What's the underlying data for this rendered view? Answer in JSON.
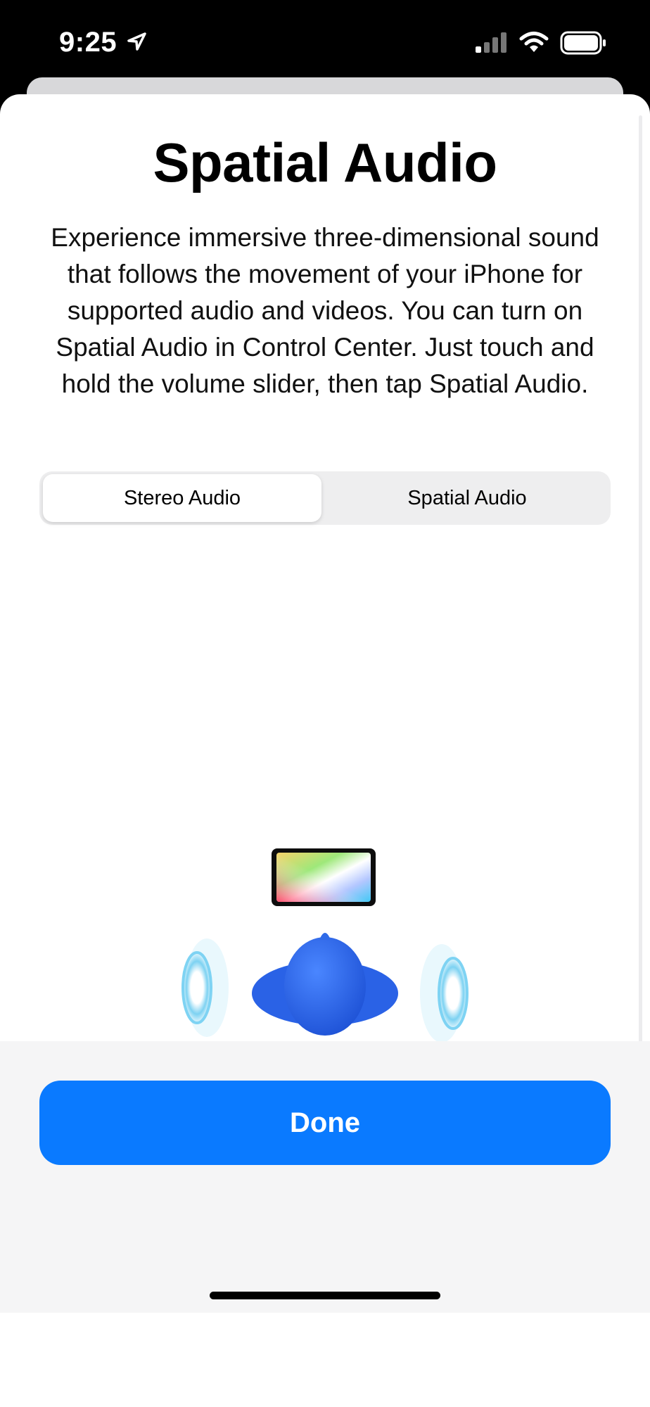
{
  "status_bar": {
    "time": "9:25",
    "location_icon": "location-arrow-icon",
    "signal_icon": "cellular-signal-icon",
    "wifi_icon": "wifi-icon",
    "battery_icon": "battery-icon"
  },
  "sheet": {
    "title": "Spatial Audio",
    "description": "Experience immersive three-dimensional sound that follows the movement of your iPhone for supported audio and videos. You can turn on Spatial Audio in Control Center. Just touch and hold the volume slider, then tap Spatial Audio.",
    "segments": [
      {
        "label": "Stereo Audio",
        "selected": true
      },
      {
        "label": "Spatial Audio",
        "selected": false
      }
    ],
    "illustration_icons": [
      "ipad-screen-icon",
      "listener-head-icon",
      "left-sound-wave-icon",
      "right-sound-wave-icon"
    ]
  },
  "footer": {
    "done_label": "Done"
  },
  "colors": {
    "accent": "#0a7aff",
    "avatar_blue": "#2f6be8",
    "wave_blue": "#8fd4f2"
  }
}
